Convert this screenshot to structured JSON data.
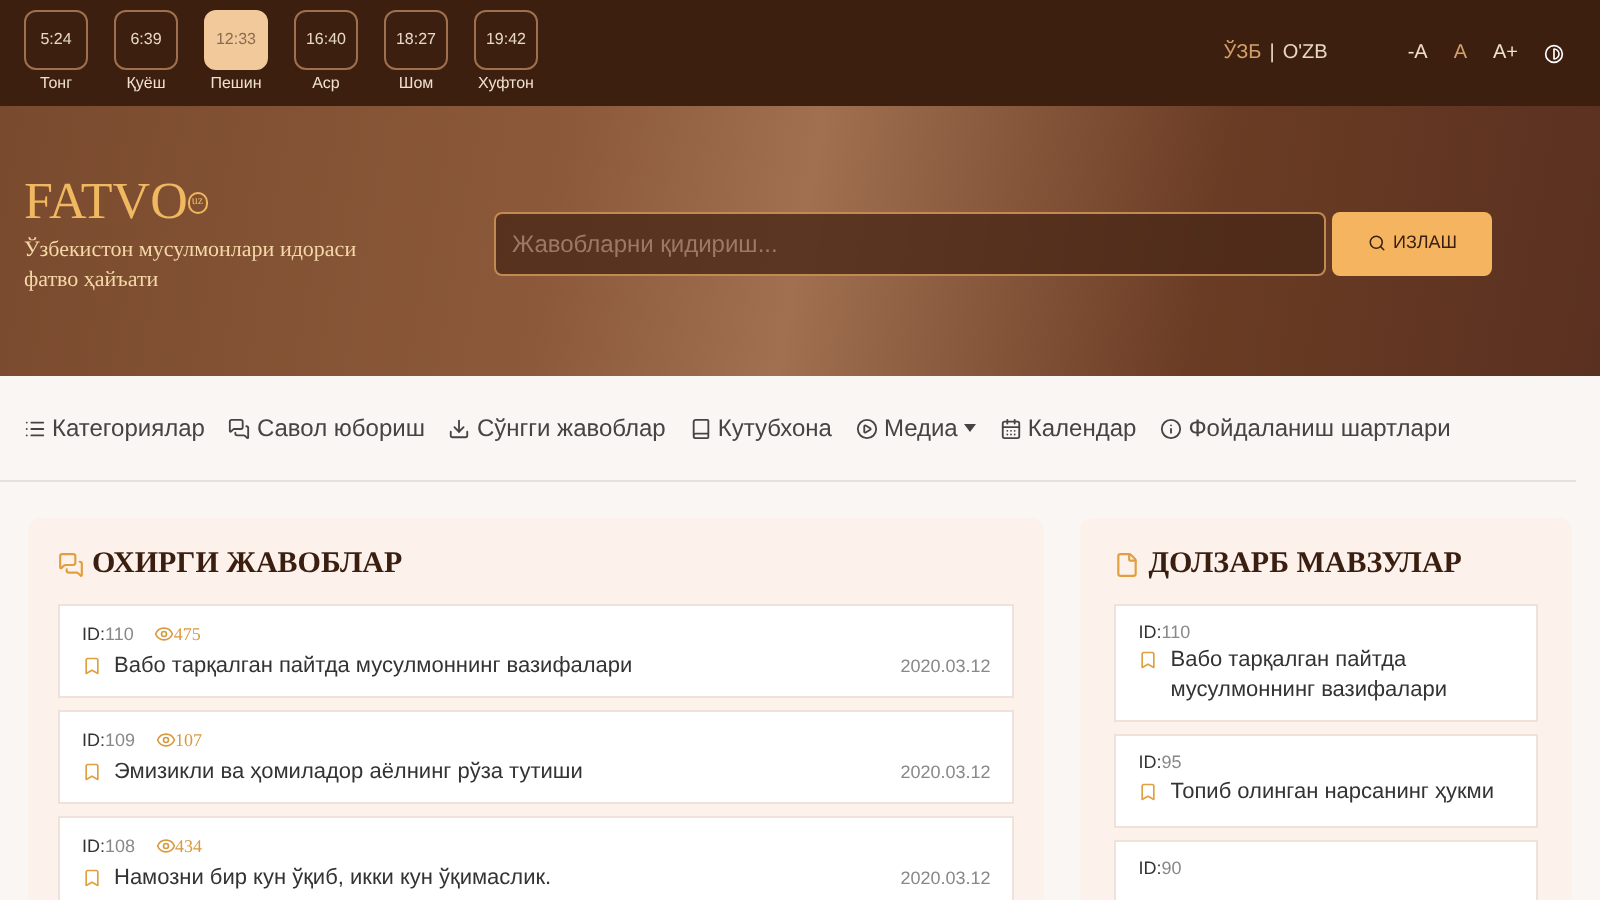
{
  "prayer_times": [
    {
      "time": "5:24",
      "name": "Тонг",
      "selected": false
    },
    {
      "time": "6:39",
      "name": "Қуёш",
      "selected": false
    },
    {
      "time": "12:33",
      "name": "Пешин",
      "selected": true
    },
    {
      "time": "16:40",
      "name": "Аср",
      "selected": false
    },
    {
      "time": "18:27",
      "name": "Шом",
      "selected": false
    },
    {
      "time": "19:42",
      "name": "Хуфтон",
      "selected": false
    }
  ],
  "languages": [
    {
      "label": "ЎЗБ",
      "selected": true
    },
    {
      "label": "O'ZB",
      "selected": false
    }
  ],
  "language_separator": "|",
  "font_sizes": [
    {
      "label": "-A",
      "selected": false
    },
    {
      "label": "A",
      "selected": true
    },
    {
      "label": "A+",
      "selected": false
    }
  ],
  "logo": {
    "text": "FATVO",
    "suffix": "uz"
  },
  "tagline": "Ўзбекистон мусулмонлари идораси фатво ҳайъати",
  "search": {
    "placeholder": "Жавобларни қидириш...",
    "button": "ИЗЛАШ"
  },
  "nav": [
    {
      "label": "Категориялар",
      "dropdown": false
    },
    {
      "label": "Савол юбориш",
      "dropdown": false
    },
    {
      "label": "Сўнгги жавоблар",
      "dropdown": false
    },
    {
      "label": "Кутубхона",
      "dropdown": false
    },
    {
      "label": "Медиа",
      "dropdown": true
    },
    {
      "label": "Календар",
      "dropdown": false
    },
    {
      "label": "Фойдаланиш шартлари",
      "dropdown": false
    }
  ],
  "latest": {
    "title": "ОХИРГИ ЖАВОБЛАР",
    "items": [
      {
        "id_label": "ID:",
        "id": "110",
        "views": "475",
        "title": "Вабо тарқалган пайтда мусулмоннинг вазифалари",
        "date": "2020.03.12"
      },
      {
        "id_label": "ID:",
        "id": "109",
        "views": "107",
        "title": "Эмизикли ва ҳомиладор аёлнинг рўза тутиши",
        "date": "2020.03.12"
      },
      {
        "id_label": "ID:",
        "id": "108",
        "views": "434",
        "title": "Намозни бир кун ўқиб, икки кун ўқимаслик.",
        "date": "2020.03.12"
      }
    ]
  },
  "topical": {
    "title": "ДОЛЗАРБ МАВЗУЛАР",
    "items": [
      {
        "id_label": "ID:",
        "id": "110",
        "title": "Вабо тарқалган пайтда мусулмоннинг вазифалари"
      },
      {
        "id_label": "ID:",
        "id": "95",
        "title": "Топиб олинган нарсанинг ҳукми"
      },
      {
        "id_label": "ID:",
        "id": "90"
      }
    ]
  }
}
